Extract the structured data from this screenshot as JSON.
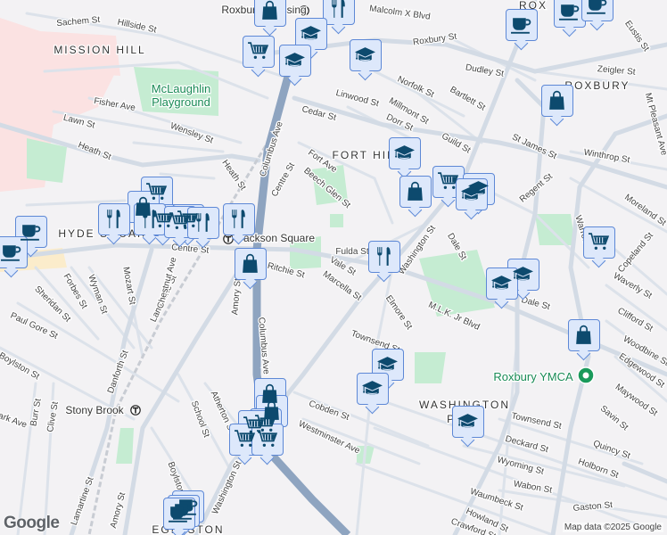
{
  "map": {
    "attribution": "Map data ©2025 Google",
    "logo": "Google",
    "colors": {
      "background": "#f3f2f4",
      "park": "#c5ecd2",
      "hospital": "#fbe2e2",
      "highway": "#8ea4c0",
      "road": "#d3dbe5",
      "marker_fill": "#dde8fb",
      "marker_border": "#5d88d6",
      "icon": "#0d4a6e",
      "poi_text": "#188a55"
    },
    "labels": [
      "Sachem St",
      "Hillside St",
      "Roxbury Crossing",
      "Malcolm X Blvd",
      "MISSION HILL",
      "McLaughlin",
      "Playground",
      "Fisher Ave",
      "Lawn St",
      "Wensley St",
      "Heath St",
      "Heath St",
      "Columbus Ave",
      "Cedar St",
      "Centre St",
      "Fort Ave",
      "Beech Glen St",
      "Roxbury St",
      "Dudley St",
      "Zeigler St",
      "ROXBURY",
      "Norfolk St",
      "Bartlett St",
      "Linwood St",
      "Millmont St",
      "Dorr St",
      "Guild St",
      "FORT HILL",
      "St James St",
      "Winthrop St",
      "Eustis St",
      "Mt Pleasant Ave",
      "Moreland St",
      "Regent St",
      "Warren St",
      "Copeland St",
      "Waverly St",
      "Clifford St",
      "Woodbine St",
      "Edgewood St",
      "Maywood St",
      "Savin St",
      "Quincy St",
      "Holborn St",
      "Gaston St",
      "Wabon St",
      "Waumbeck St",
      "Wyoming St",
      "Deckard St",
      "Townsend St",
      "Howland St",
      "Roxbury YMCA",
      "WASHINGTON",
      "PARK",
      "M.L.K. Jr Blvd",
      "Elmore St",
      "Townsend St",
      "Cobden St",
      "Westminster Ave",
      "Dale St",
      "Dale St",
      "Washington St",
      "Vale St",
      "Marcella St",
      "Fulda St",
      "Ritchie St",
      "Jackson Square",
      "Centre St",
      "Amory St",
      "Columbus Ave",
      "Lamartine St",
      "Lamartine St",
      "Chestnut Ave",
      "Mozart St",
      "Wyman St",
      "Forbes St",
      "Sheridan St",
      "Paul Gore St",
      "Danforth St",
      "Boylston St",
      "Burr St",
      "Clive St",
      "Stony Brook",
      "Amory St",
      "School St",
      "Atherton St",
      "Boylston St",
      "Washington St",
      "EGLESTON",
      "Park Ave",
      "HYDE SQUARE",
      "ROX",
      "Crawford St"
    ],
    "markers": [
      {
        "icon": "shop-icon",
        "category": "shop"
      },
      {
        "icon": "restaurant-icon",
        "category": "restaurant"
      },
      {
        "icon": "school-icon",
        "category": "school"
      },
      {
        "icon": "cart-icon",
        "category": "grocery"
      },
      {
        "icon": "school-icon",
        "category": "school"
      },
      {
        "icon": "school-icon",
        "category": "school"
      },
      {
        "icon": "coffee-icon",
        "category": "cafe"
      },
      {
        "icon": "coffee-icon",
        "category": "cafe"
      },
      {
        "icon": "coffee-icon",
        "category": "cafe"
      },
      {
        "icon": "shop-icon",
        "category": "shop"
      },
      {
        "icon": "school-icon",
        "category": "school"
      },
      {
        "icon": "cart-icon",
        "category": "grocery"
      },
      {
        "icon": "school-icon",
        "category": "school"
      },
      {
        "icon": "shop-icon",
        "category": "shop"
      },
      {
        "icon": "school-icon",
        "category": "school"
      },
      {
        "icon": "cart-icon",
        "category": "grocery"
      },
      {
        "icon": "school-icon",
        "category": "school"
      },
      {
        "icon": "school-icon",
        "category": "school"
      },
      {
        "icon": "restaurant-icon",
        "category": "restaurant"
      },
      {
        "icon": "shop-icon",
        "category": "shop"
      },
      {
        "icon": "school-icon",
        "category": "school"
      },
      {
        "icon": "school-icon",
        "category": "school"
      },
      {
        "icon": "school-icon",
        "category": "school"
      },
      {
        "icon": "shop-icon",
        "category": "shop"
      },
      {
        "icon": "cart-icon",
        "category": "grocery"
      },
      {
        "icon": "shop-icon",
        "category": "shop"
      },
      {
        "icon": "restaurant-icon",
        "category": "restaurant"
      },
      {
        "icon": "cart-icon",
        "category": "grocery"
      },
      {
        "icon": "restaurant-icon",
        "category": "restaurant"
      },
      {
        "icon": "cart-icon",
        "category": "grocery"
      },
      {
        "icon": "cart-icon",
        "category": "grocery"
      },
      {
        "icon": "restaurant-icon",
        "category": "restaurant"
      },
      {
        "icon": "restaurant-icon",
        "category": "restaurant"
      },
      {
        "icon": "coffee-icon",
        "category": "cafe"
      },
      {
        "icon": "coffee-icon",
        "category": "cafe"
      },
      {
        "icon": "shop-icon",
        "category": "shop"
      },
      {
        "icon": "shop-icon",
        "category": "shop"
      },
      {
        "icon": "cart-icon",
        "category": "grocery"
      },
      {
        "icon": "cart-icon",
        "category": "grocery"
      },
      {
        "icon": "cart-icon",
        "category": "grocery"
      },
      {
        "icon": "cart-icon",
        "category": "grocery"
      },
      {
        "icon": "coffee-icon",
        "category": "cafe"
      },
      {
        "icon": "coffee-icon",
        "category": "cafe"
      },
      {
        "icon": "coffee-icon",
        "category": "cafe"
      }
    ]
  }
}
